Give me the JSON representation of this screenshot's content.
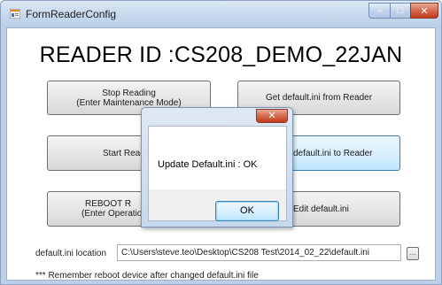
{
  "window": {
    "title": "FormReaderConfig",
    "minimize_glyph": "–",
    "maximize_glyph": "□",
    "close_glyph": "✕"
  },
  "main": {
    "reader_id": "READER ID :CS208_DEMO_22JAN",
    "buttons": {
      "stop_reading": {
        "line1": "Stop Reading",
        "line2": "(Enter Maintenance Mode)"
      },
      "get_default": {
        "line1": "Get default.ini from Reader"
      },
      "start_reading": {
        "line1": "Start Read"
      },
      "update_default": {
        "line1": "default.ini to Reader"
      },
      "reboot": {
        "line1": "REBOOT R",
        "line2": "(Enter Operatio"
      },
      "edit_default": {
        "line1": "Edit default.ini"
      }
    },
    "location_label": "default.ini location",
    "location_value": "C:\\Users\\steve.teo\\Desktop\\CS208 Test\\2014_02_22\\default.ini",
    "browse_label": "...",
    "note": "*** Remember reboot device after changed default.ini file"
  },
  "dialog": {
    "close_glyph": "✕",
    "message": "Update Default.ini : OK",
    "ok_label": "OK"
  },
  "colors": {
    "titlebar": "#c4d7ec",
    "close_button": "#c2391c",
    "hot_button": "#bee6fd"
  }
}
